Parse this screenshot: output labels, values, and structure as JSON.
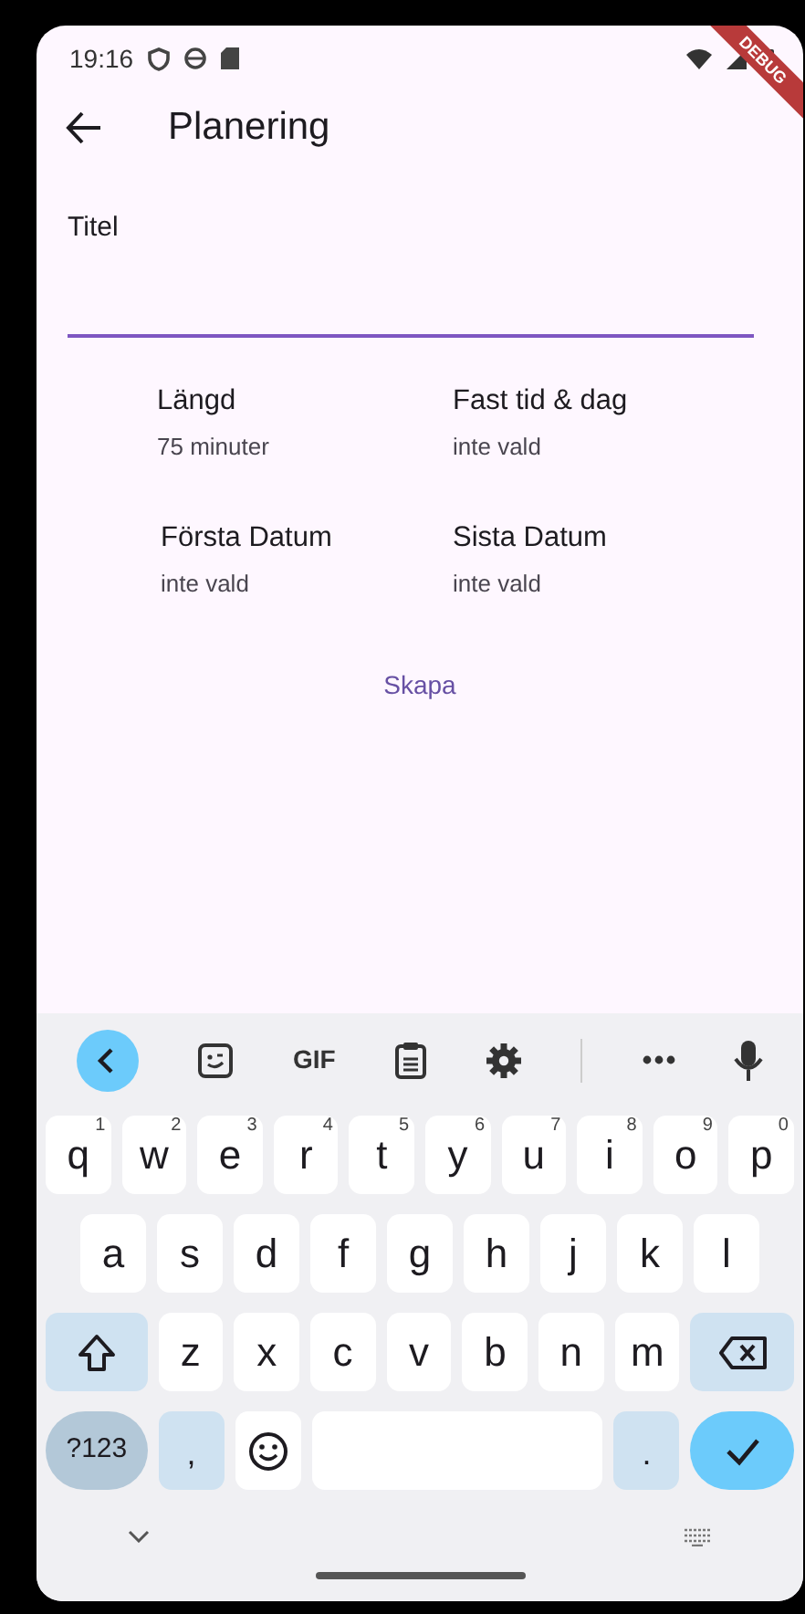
{
  "status_bar": {
    "time": "19:16"
  },
  "debug_banner": "DEBUG",
  "app_bar": {
    "title": "Planering"
  },
  "title_field": {
    "label": "Titel",
    "focused": true
  },
  "fields": [
    {
      "label": "Längd",
      "value": "75 minuter"
    },
    {
      "label": "Fast tid & dag",
      "value": "inte vald"
    },
    {
      "label": "Första Datum",
      "value": "inte vald"
    },
    {
      "label": "Sista Datum",
      "value": "inte vald"
    }
  ],
  "create_button": "Skapa",
  "keyboard": {
    "toolbar": [
      {
        "kind": "back"
      },
      {
        "kind": "sticker"
      },
      {
        "kind": "text",
        "label": "GIF"
      },
      {
        "kind": "clipboard"
      },
      {
        "kind": "settings"
      },
      {
        "kind": "divider"
      },
      {
        "kind": "more"
      },
      {
        "kind": "mic"
      }
    ],
    "rows": [
      {
        "keys": [
          {
            "kind": "letter",
            "label": "q",
            "hint": "1"
          },
          {
            "kind": "letter",
            "label": "w",
            "hint": "2"
          },
          {
            "kind": "letter",
            "label": "e",
            "hint": "3"
          },
          {
            "kind": "letter",
            "label": "r",
            "hint": "4"
          },
          {
            "kind": "letter",
            "label": "t",
            "hint": "5"
          },
          {
            "kind": "letter",
            "label": "y",
            "hint": "6"
          },
          {
            "kind": "letter",
            "label": "u",
            "hint": "7"
          },
          {
            "kind": "letter",
            "label": "i",
            "hint": "8"
          },
          {
            "kind": "letter",
            "label": "o",
            "hint": "9"
          },
          {
            "kind": "letter",
            "label": "p",
            "hint": "0"
          }
        ]
      },
      {
        "keys": [
          {
            "kind": "letter",
            "label": "a"
          },
          {
            "kind": "letter",
            "label": "s"
          },
          {
            "kind": "letter",
            "label": "d"
          },
          {
            "kind": "letter",
            "label": "f"
          },
          {
            "kind": "letter",
            "label": "g"
          },
          {
            "kind": "letter",
            "label": "h"
          },
          {
            "kind": "letter",
            "label": "j"
          },
          {
            "kind": "letter",
            "label": "k"
          },
          {
            "kind": "letter",
            "label": "l"
          }
        ]
      },
      {
        "keys": [
          {
            "kind": "shift"
          },
          {
            "kind": "letter",
            "label": "z"
          },
          {
            "kind": "letter",
            "label": "x"
          },
          {
            "kind": "letter",
            "label": "c"
          },
          {
            "kind": "letter",
            "label": "v"
          },
          {
            "kind": "letter",
            "label": "b"
          },
          {
            "kind": "letter",
            "label": "n"
          },
          {
            "kind": "letter",
            "label": "m"
          },
          {
            "kind": "backspace"
          }
        ]
      },
      {
        "keys": [
          {
            "kind": "symbols",
            "label": "?123"
          },
          {
            "kind": "punct",
            "label": ","
          },
          {
            "kind": "emoji"
          },
          {
            "kind": "space"
          },
          {
            "kind": "punct",
            "label": "."
          },
          {
            "kind": "enter"
          }
        ]
      }
    ]
  }
}
